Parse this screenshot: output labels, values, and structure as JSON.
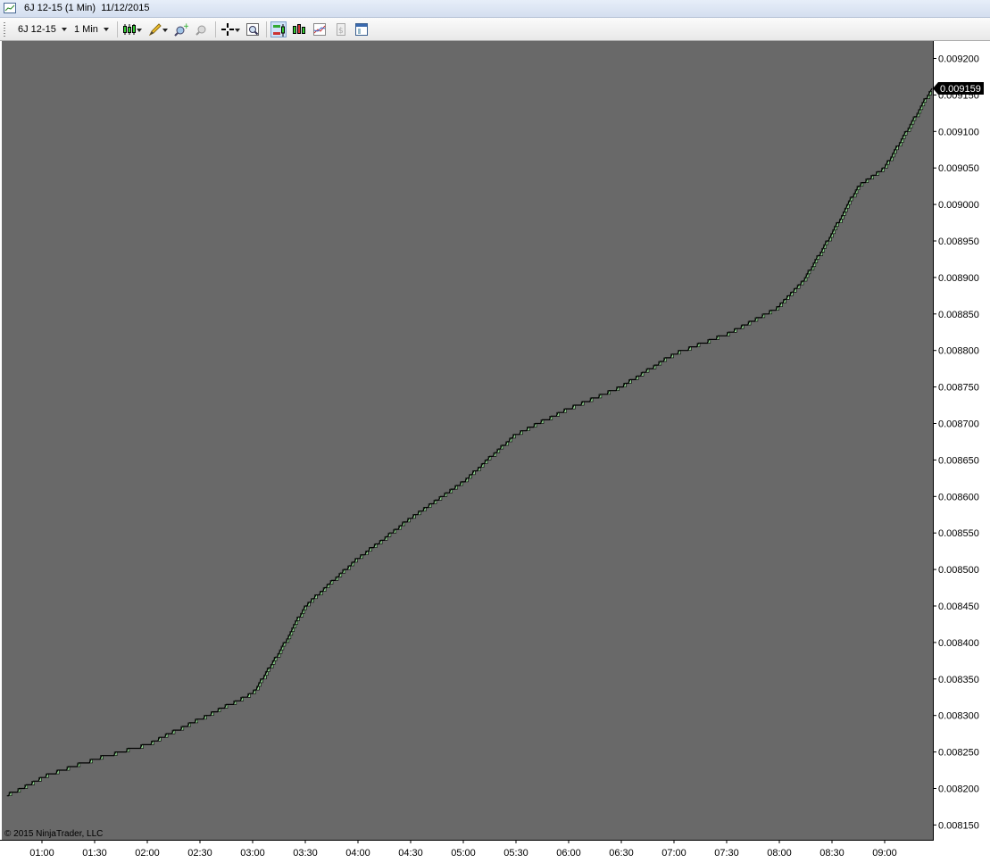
{
  "window": {
    "title": "6J 12-15 (1 Min)  11/12/2015"
  },
  "toolbar": {
    "instrument": "6J 12-15",
    "interval": "1 Min",
    "buttons": [
      {
        "name": "bar-type-icon"
      },
      {
        "name": "drawing-tool-icon"
      },
      {
        "name": "zoom-in-icon"
      },
      {
        "name": "zoom-out-icon"
      },
      {
        "name": "crosshair-icon"
      },
      {
        "name": "data-box-icon"
      },
      {
        "name": "chart-trader-icon"
      },
      {
        "name": "indicators-icon"
      },
      {
        "name": "strategies-icon"
      },
      {
        "name": "market-analyzer-icon"
      },
      {
        "name": "properties-icon"
      }
    ]
  },
  "chart": {
    "background_color": "#696969",
    "axis_bg": "#ffffff",
    "up_color": "#8fd48f",
    "copyright": "© 2015 NinjaTrader, LLC",
    "current_price": "0.009159",
    "price_labels": [
      "0.009200",
      "0.009150",
      "0.009100",
      "0.009050",
      "0.009000",
      "0.008950",
      "0.008900",
      "0.008850",
      "0.008800",
      "0.008750",
      "0.008700",
      "0.008650",
      "0.008600",
      "0.008550",
      "0.008500",
      "0.008450",
      "0.008400",
      "0.008350",
      "0.008300",
      "0.008250",
      "0.008200",
      "0.008150"
    ],
    "time_labels": [
      "01:00",
      "01:30",
      "02:00",
      "02:30",
      "03:00",
      "03:30",
      "04:00",
      "04:30",
      "05:00",
      "05:30",
      "06:00",
      "06:30",
      "07:00",
      "07:30",
      "08:00",
      "08:30",
      "09:00"
    ]
  },
  "chart_data": {
    "type": "line",
    "title": "6J 12-15 (1 Min)",
    "xlabel": "",
    "ylabel": "",
    "ylim": [
      0.008135,
      0.009215
    ],
    "x": [
      "00:40",
      "01:00",
      "01:30",
      "02:00",
      "02:30",
      "03:00",
      "03:15",
      "03:30",
      "04:00",
      "04:30",
      "05:00",
      "05:30",
      "06:00",
      "06:30",
      "07:00",
      "07:30",
      "08:00",
      "08:15",
      "08:30",
      "08:45",
      "09:00",
      "09:15",
      "09:27"
    ],
    "series": [
      {
        "values": [
          0.00819,
          0.008215,
          0.00824,
          0.00826,
          0.008295,
          0.00833,
          0.008385,
          0.00845,
          0.008515,
          0.00857,
          0.00862,
          0.008685,
          0.00872,
          0.00875,
          0.008795,
          0.008822,
          0.00886,
          0.0089,
          0.00896,
          0.009025,
          0.00905,
          0.00911,
          0.009159
        ]
      }
    ],
    "grid": false
  }
}
